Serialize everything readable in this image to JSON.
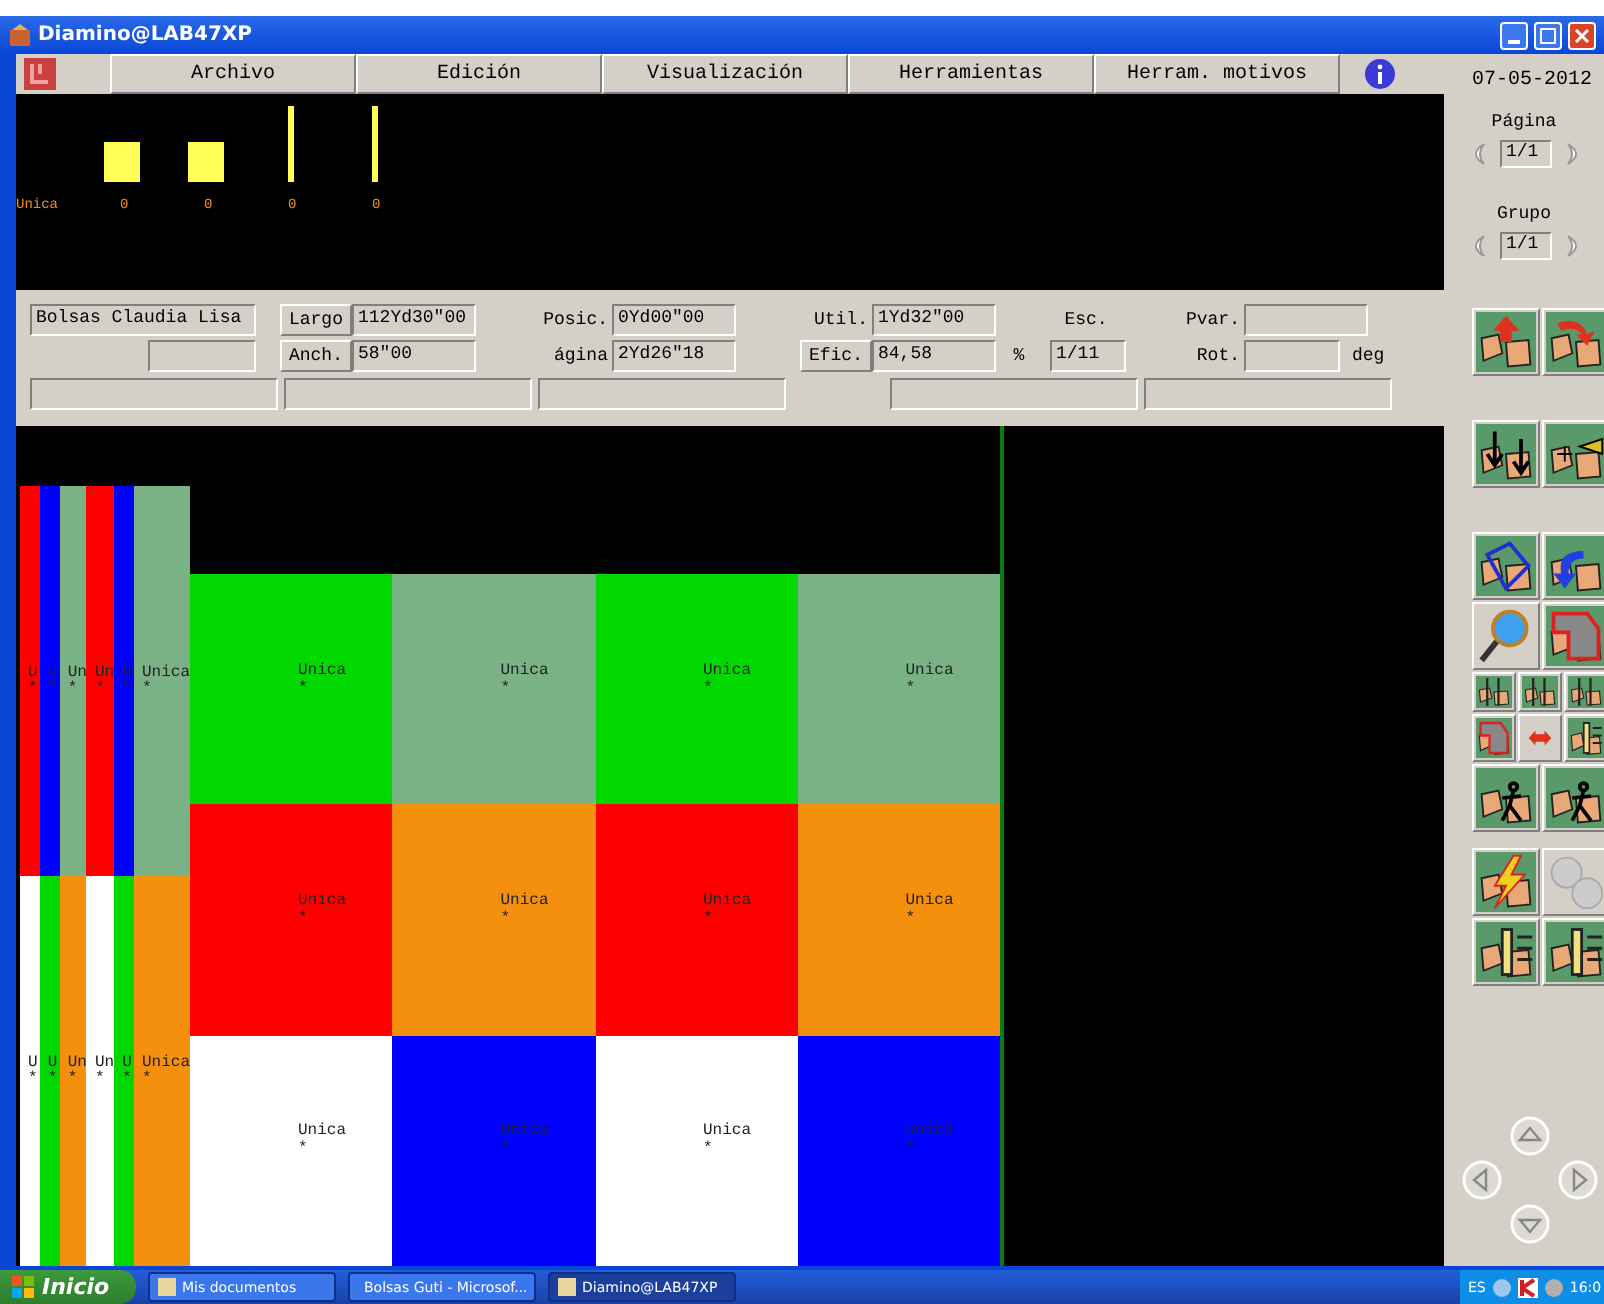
{
  "window": {
    "title": "Diamino@LAB47XP"
  },
  "menu": [
    {
      "label": "Archivo"
    },
    {
      "label": "Edición"
    },
    {
      "label": "Visualización"
    },
    {
      "label": "Herramientas"
    },
    {
      "label": "Herram. motivos"
    }
  ],
  "date": "07-05-2012",
  "pagers": [
    {
      "label": "Página",
      "value": "1/1"
    },
    {
      "label": "Grupo",
      "value": "1/1"
    }
  ],
  "preview": {
    "name": "Unica",
    "items": [
      {
        "kind": "square",
        "count": "0"
      },
      {
        "kind": "square",
        "count": "0"
      },
      {
        "kind": "line",
        "count": "0"
      },
      {
        "kind": "line",
        "count": "0"
      }
    ]
  },
  "info": {
    "model": "Bolsas Claudia Lisa",
    "largo_button": "Largo",
    "largo": "112Yd30\"00",
    "anch_button": "Anch.",
    "anch": "58\"00",
    "posic_label": "Posic.",
    "posic": "0Yd00\"00",
    "pagina_label": "ágina",
    "pagina": "2Yd26\"18",
    "util_label": "Util.",
    "util": "1Yd32\"00",
    "efic_button": "Efic.",
    "efic": "84,58",
    "efic_unit": "%",
    "esc_label": "Esc.",
    "esc": "1/11",
    "pvar_label": "Pvar.",
    "rot_label": "Rot.",
    "rot_unit": "deg"
  },
  "strip_rows": [
    [
      {
        "color": "#ff0000",
        "label": "U",
        "mark": "*"
      },
      {
        "color": "#0000ff",
        "label": "U",
        "mark": "*"
      },
      {
        "color": "#7bb285",
        "label": "Un",
        "mark": "*"
      },
      {
        "color": "#ff0000",
        "label": "Un",
        "mark": "*"
      },
      {
        "color": "#0000ff",
        "label": "U",
        "mark": "*"
      },
      {
        "color": "#7bb285",
        "label": "Unica",
        "mark": "*"
      }
    ],
    [
      {
        "color": "#ffffff",
        "label": "U",
        "mark": "*"
      },
      {
        "color": "#00d800",
        "label": "U",
        "mark": "*"
      },
      {
        "color": "#f5900f",
        "label": "Un",
        "mark": "*"
      },
      {
        "color": "#ffffff",
        "label": "Un",
        "mark": "*"
      },
      {
        "color": "#00d800",
        "label": "U",
        "mark": "*"
      },
      {
        "color": "#f5900f",
        "label": "Unica",
        "mark": "*"
      }
    ]
  ],
  "piece_rows": [
    [
      {
        "color": "#00d800",
        "label": "Unica",
        "mark": "*"
      },
      {
        "color": "#7bb285",
        "label": "Unica",
        "mark": "*"
      },
      {
        "color": "#00d800",
        "label": "Unica",
        "mark": "*"
      },
      {
        "color": "#7bb285",
        "label": "Unica",
        "mark": "*"
      }
    ],
    [
      {
        "color": "#ff0000",
        "label": "Unica",
        "mark": "*"
      },
      {
        "color": "#f5900f",
        "label": "Unica",
        "mark": "*"
      },
      {
        "color": "#ff0000",
        "label": "Unica",
        "mark": "*"
      },
      {
        "color": "#f5900f",
        "label": "Unica",
        "mark": "*"
      }
    ],
    [
      {
        "color": "#ffffff",
        "label": "Unica",
        "mark": "*"
      },
      {
        "color": "#0000ff",
        "label": "Unica",
        "mark": "*"
      },
      {
        "color": "#ffffff",
        "label": "Unica",
        "mark": "*"
      },
      {
        "color": "#0000ff",
        "label": "Unica",
        "mark": "*"
      }
    ]
  ],
  "taskbar": {
    "start": "Inicio",
    "tasks": [
      {
        "label": "Mis documentos",
        "selected": false
      },
      {
        "label": "Bolsas Guti - Microsof...",
        "selected": false
      },
      {
        "label": "Diamino@LAB47XP",
        "selected": true
      }
    ],
    "language": "ES",
    "clock": "16:0"
  }
}
